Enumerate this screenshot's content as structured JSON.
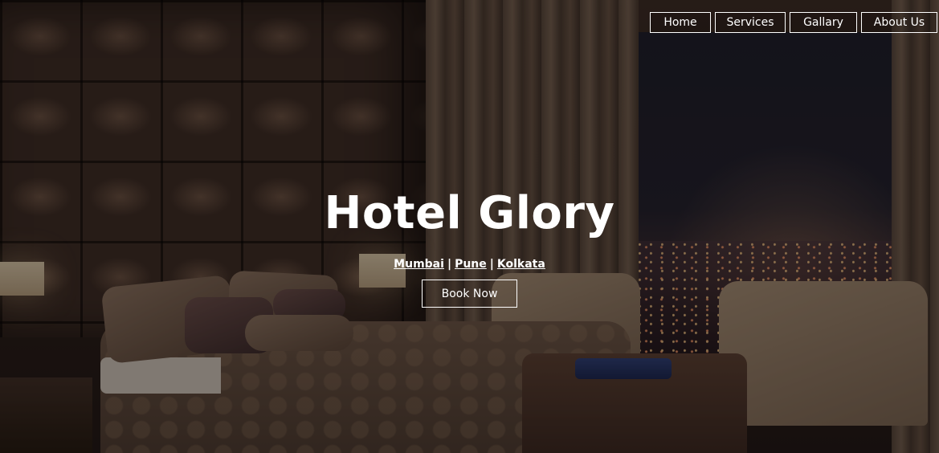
{
  "nav": {
    "items": [
      {
        "label": "Home"
      },
      {
        "label": "Services"
      },
      {
        "label": "Gallary"
      },
      {
        "label": "About Us"
      }
    ]
  },
  "hero": {
    "title": "Hotel Glory",
    "locations": [
      "Mumbai",
      "Pune",
      "Kolkata"
    ],
    "separator": "|",
    "cta_label": "Book Now",
    "background_image": "hotel-bedroom-photo"
  },
  "colors": {
    "text": "#ffffff",
    "border": "#ffffff",
    "overlay": "#0a0604"
  }
}
